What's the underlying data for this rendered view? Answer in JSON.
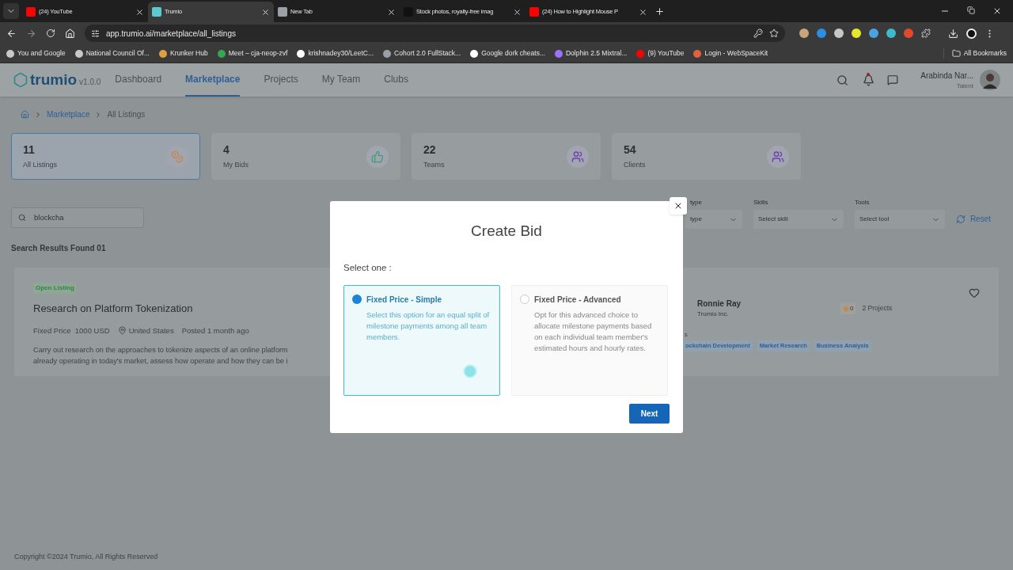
{
  "browser": {
    "tabs": [
      {
        "title": "(24) YouTube",
        "selected": false,
        "color": "#ff0000"
      },
      {
        "title": "Trumio",
        "selected": true,
        "color": "#5fc7cf"
      },
      {
        "title": "New Tab",
        "selected": false,
        "color": "#9aa0a6"
      },
      {
        "title": "Stock photos, royalty-free imag",
        "selected": false,
        "color": "#111111"
      },
      {
        "title": "(24) How to Highlight Mouse P",
        "selected": false,
        "color": "#ff0000"
      }
    ],
    "address": "app.trumio.ai/marketplace/all_listings",
    "bookmarks": [
      {
        "label": "You and Google",
        "color": "#c8c8c8"
      },
      {
        "label": "National Council Of...",
        "color": "#c8c8c8"
      },
      {
        "label": "Krunker Hub",
        "color": "#e0a040"
      },
      {
        "label": "Meet – cja-neop-zvf",
        "color": "#34a853"
      },
      {
        "label": "krishnadey30/LeetC...",
        "color": "#ffffff"
      },
      {
        "label": "Cohort 2.0 FullStack...",
        "color": "#9aa0a6"
      },
      {
        "label": "Google dork cheats...",
        "color": "#ffffff"
      },
      {
        "label": "Dolphin 2.5 Mixtral...",
        "color": "#a070ff"
      },
      {
        "label": "(9) YouTube",
        "color": "#ff0000"
      },
      {
        "label": "Login - WebSpaceKit",
        "color": "#e06040"
      }
    ],
    "all_bookmarks": "All Bookmarks"
  },
  "app": {
    "logo": "trumio",
    "version": "v1.0.0",
    "nav": [
      {
        "label": "Dashboard",
        "selected": false
      },
      {
        "label": "Marketplace",
        "selected": true
      },
      {
        "label": "Projects",
        "selected": false
      },
      {
        "label": "My Team",
        "selected": false
      },
      {
        "label": "Clubs",
        "selected": false
      }
    ],
    "has_notifications": true,
    "user": {
      "name": "Arabinda Nar...",
      "role": "Talent"
    }
  },
  "breadcrumb": [
    "Marketplace",
    "All Listings"
  ],
  "stats": [
    {
      "value": "11",
      "label": "All Listings",
      "selected": true,
      "kind": "coins",
      "color": "#c8874a"
    },
    {
      "value": "4",
      "label": "My Bids",
      "selected": false,
      "kind": "thumbs",
      "color": "#3f9f73"
    },
    {
      "value": "22",
      "label": "Teams",
      "selected": false,
      "kind": "users",
      "color": "#6a3fb3"
    },
    {
      "value": "54",
      "label": "Clients",
      "selected": false,
      "kind": "users",
      "color": "#6a3fb3"
    }
  ],
  "search": {
    "value": "blockcha"
  },
  "filters": [
    {
      "label": "type",
      "placeholder": "type"
    },
    {
      "label": "Skills",
      "placeholder": "Select skill"
    },
    {
      "label": "Tools",
      "placeholder": "Select tool"
    }
  ],
  "reset": "Reset",
  "results_heading": "Search Results Found 01",
  "listing": {
    "status": "Open Listing",
    "title": "Research on Platform Tokenization",
    "price_label": "Fixed Price",
    "price": "1000 USD",
    "location": "United States",
    "posted": "Posted 1 month ago",
    "description": [
      "Carry out research on the approaches to tokenize aspects of an online platform",
      "already operating in today's market, assess how operate and how they can be i"
    ],
    "client": "Ronnie Ray",
    "company": "Trumio Inc.",
    "rating": "0",
    "projects": "2 Projects",
    "skills_label": "s",
    "tags": [
      "ockchain Development",
      "Market Research",
      "Business Analysis"
    ],
    "favorited": false
  },
  "modal": {
    "title": "Create Bid",
    "prompt": "Select one :",
    "options": [
      {
        "title": "Fixed Price - Simple",
        "description": "Select this option for an equal split of milestone payments among all team members.",
        "selected": true
      },
      {
        "title": "Fixed Price - Advanced",
        "description": "Opt for this advanced choice to allocate milestone payments based on each individual team member's estimated hours and hourly rates.",
        "selected": false
      }
    ],
    "next": "Next"
  },
  "footer": "Copyright ©2024 Trumio, All Rights Reserved"
}
